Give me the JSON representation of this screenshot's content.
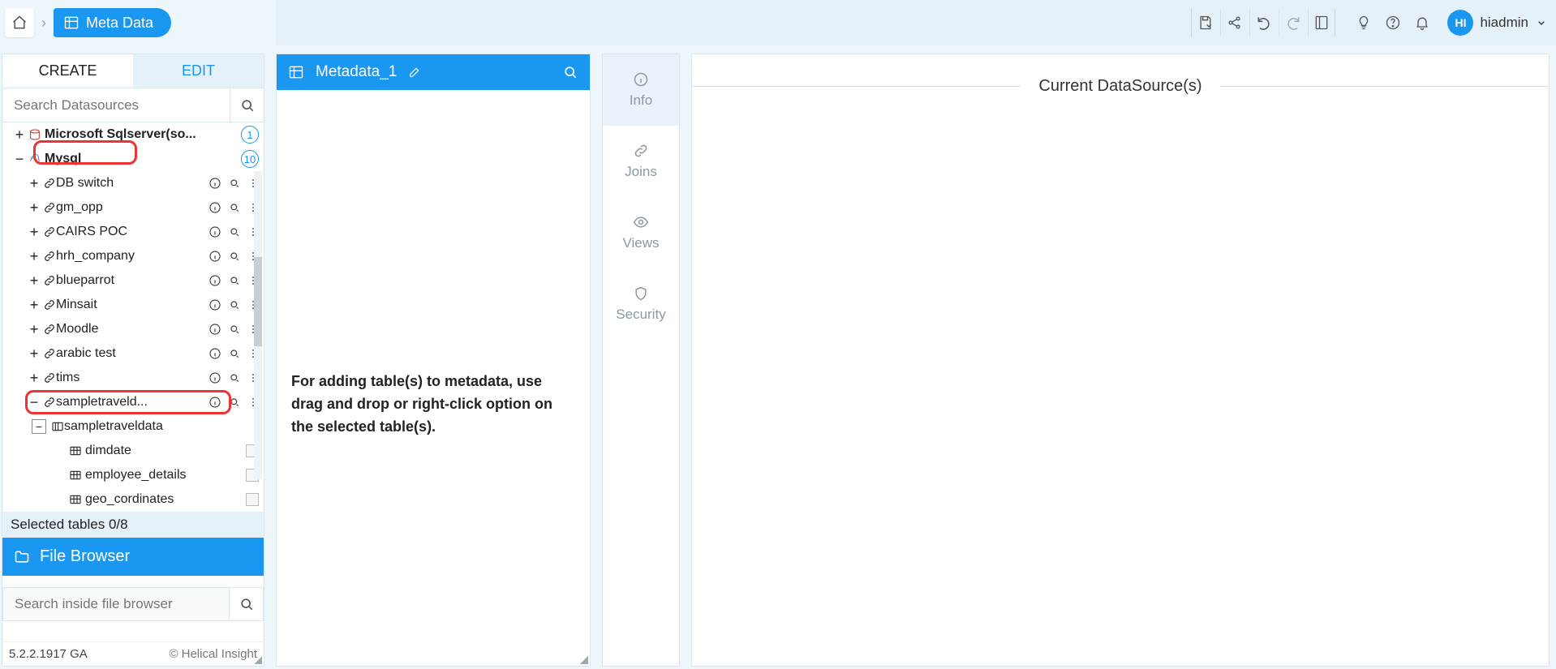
{
  "breadcrumb": {
    "page": "Meta Data"
  },
  "topbar": {
    "user_initials": "HI",
    "user_name": "hiadmin"
  },
  "left": {
    "tabs": {
      "create": "CREATE",
      "edit": "EDIT"
    },
    "search_placeholder": "Search Datasources",
    "ds": [
      {
        "name": "Microsoft Sqlserver(so...",
        "count": "1",
        "expanded": false,
        "bold": true
      },
      {
        "name": "Mysql",
        "count": "10",
        "expanded": true,
        "bold": true,
        "connections": [
          {
            "name": "DB switch"
          },
          {
            "name": "gm_opp"
          },
          {
            "name": "CAIRS POC"
          },
          {
            "name": "hrh_company"
          },
          {
            "name": "blueparrot"
          },
          {
            "name": "Minsait"
          },
          {
            "name": "Moodle"
          },
          {
            "name": "arabic test"
          },
          {
            "name": "tims"
          },
          {
            "name": "sampletraveld...",
            "expanded": true,
            "schemas": [
              {
                "name": "sampletraveldata",
                "expanded": true,
                "tables": [
                  {
                    "name": "dimdate"
                  },
                  {
                    "name": "employee_details"
                  },
                  {
                    "name": "geo_cordinates"
                  }
                ]
              }
            ]
          }
        ]
      }
    ],
    "selected_tables_label": "Selected tables 0/8",
    "file_browser": "File Browser",
    "file_search_placeholder": "Search inside file browser",
    "version": "5.2.2.1917 GA",
    "brand": "Helical Insight"
  },
  "metadata_panel": {
    "title": "Metadata_1",
    "help": "For adding table(s) to metadata, use drag and drop or right-click option on the selected table(s)."
  },
  "right_tabs": {
    "info": "Info",
    "joins": "Joins",
    "views": "Views",
    "security": "Security"
  },
  "canvas": {
    "heading": "Current DataSource(s)"
  }
}
